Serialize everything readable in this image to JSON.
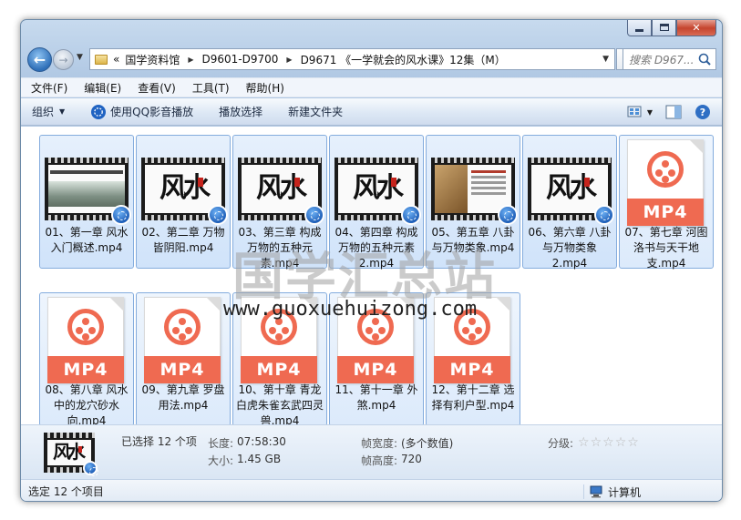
{
  "address": {
    "overflow": "«",
    "segments": [
      "国学资料馆",
      "D9601-D9700",
      "D9671 《一学就会的风水课》12集（M）"
    ]
  },
  "search": {
    "placeholder": "搜索 D967..."
  },
  "menu": [
    "文件(F)",
    "编辑(E)",
    "查看(V)",
    "工具(T)",
    "帮助(H)"
  ],
  "toolbar": {
    "organize": "组织",
    "qq_play": "使用QQ影音播放",
    "play_selection": "播放选择",
    "new_folder": "新建文件夹"
  },
  "files": [
    {
      "name": "01、第一章 风水入门概述.mp4",
      "thumb": "scene"
    },
    {
      "name": "02、第二章 万物皆阴阳.mp4",
      "thumb": "calligraphy"
    },
    {
      "name": "03、第三章 构成万物的五种元素.mp4",
      "thumb": "calligraphy"
    },
    {
      "name": "04、第四章 构成万物的五种元素2.mp4",
      "thumb": "calligraphy"
    },
    {
      "name": "05、第五章 八卦与万物类象.mp4",
      "thumb": "parchment"
    },
    {
      "name": "06、第六章 八卦与万物类象2.mp4",
      "thumb": "calligraphy"
    },
    {
      "name": "07、第七章 河图洛书与天干地支.mp4",
      "thumb": "mp4"
    },
    {
      "name": "08、第八章 风水中的龙穴砂水向.mp4",
      "thumb": "mp4"
    },
    {
      "name": "09、第九章 罗盘用法.mp4",
      "thumb": "mp4"
    },
    {
      "name": "10、第十章 青龙白虎朱雀玄武四灵兽.mp4",
      "thumb": "mp4"
    },
    {
      "name": "11、第十一章 外煞.mp4",
      "thumb": "mp4"
    },
    {
      "name": "12、第十二章 选择有利户型.mp4",
      "thumb": "mp4"
    }
  ],
  "thumb_text": {
    "calligraphy": "风水",
    "mp4_badge": "MP4"
  },
  "watermark": {
    "cn": "国学汇总站",
    "url": "www.guoxuehuizong.com"
  },
  "details": {
    "selected": "已选择 12 个项",
    "length_label": "长度:",
    "length_value": "07:58:30",
    "size_label": "大小:",
    "size_value": "1.45 GB",
    "width_label": "帧宽度:",
    "width_value": "(多个数值)",
    "height_label": "帧高度:",
    "height_value": "720",
    "rating_label": "分级:",
    "rating": 0,
    "rating_max": 5
  },
  "status": {
    "left": "选定 12 个项目",
    "right": "计算机"
  },
  "colors": {
    "mp4_orange": "#ef6a51",
    "selection": "#d0e3fa",
    "window_frame": "#b9cfe8"
  }
}
